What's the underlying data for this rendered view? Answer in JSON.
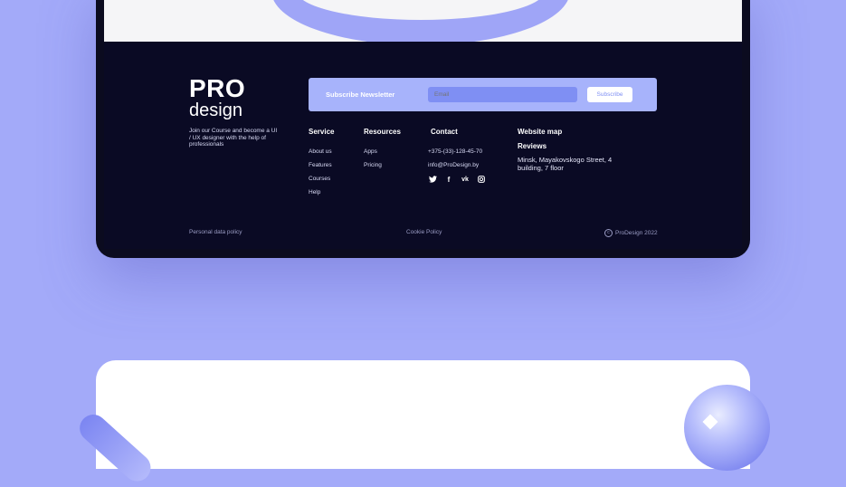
{
  "brand": {
    "line1": "PRO",
    "line2": "design"
  },
  "tagline": "Join our Course and become a UI / UX designer with the help of professionals",
  "newsletter": {
    "label": "Subscribe Newsletter",
    "placeholder": "Email",
    "button": "Subscribe"
  },
  "columns": {
    "service": {
      "title": "Service",
      "links": [
        "About us",
        "Features",
        "Courses",
        "Help"
      ]
    },
    "resources": {
      "title": "Resources",
      "links": [
        "Apps",
        "Pricing"
      ]
    },
    "contact": {
      "title": "Contact",
      "phone": "+375-(33)-128-45-70",
      "email": "info@ProDesign.by",
      "social_icons": [
        "twitter-icon",
        "facebook-icon",
        "vk-icon",
        "instagram-icon"
      ]
    },
    "site": {
      "sitemap": "Website map",
      "reviews": "Reviews",
      "address": "Minsk, Mayakovskogo Street, 4 building, 7 floor"
    }
  },
  "footer": {
    "privacy": "Personal data policy",
    "cookie": "Cookie Policy",
    "copyright": "ProDesign 2022"
  },
  "colors": {
    "accent": "#a7b3fb",
    "background": "#a3aaf9",
    "footer_bg": "#0a0a24"
  }
}
